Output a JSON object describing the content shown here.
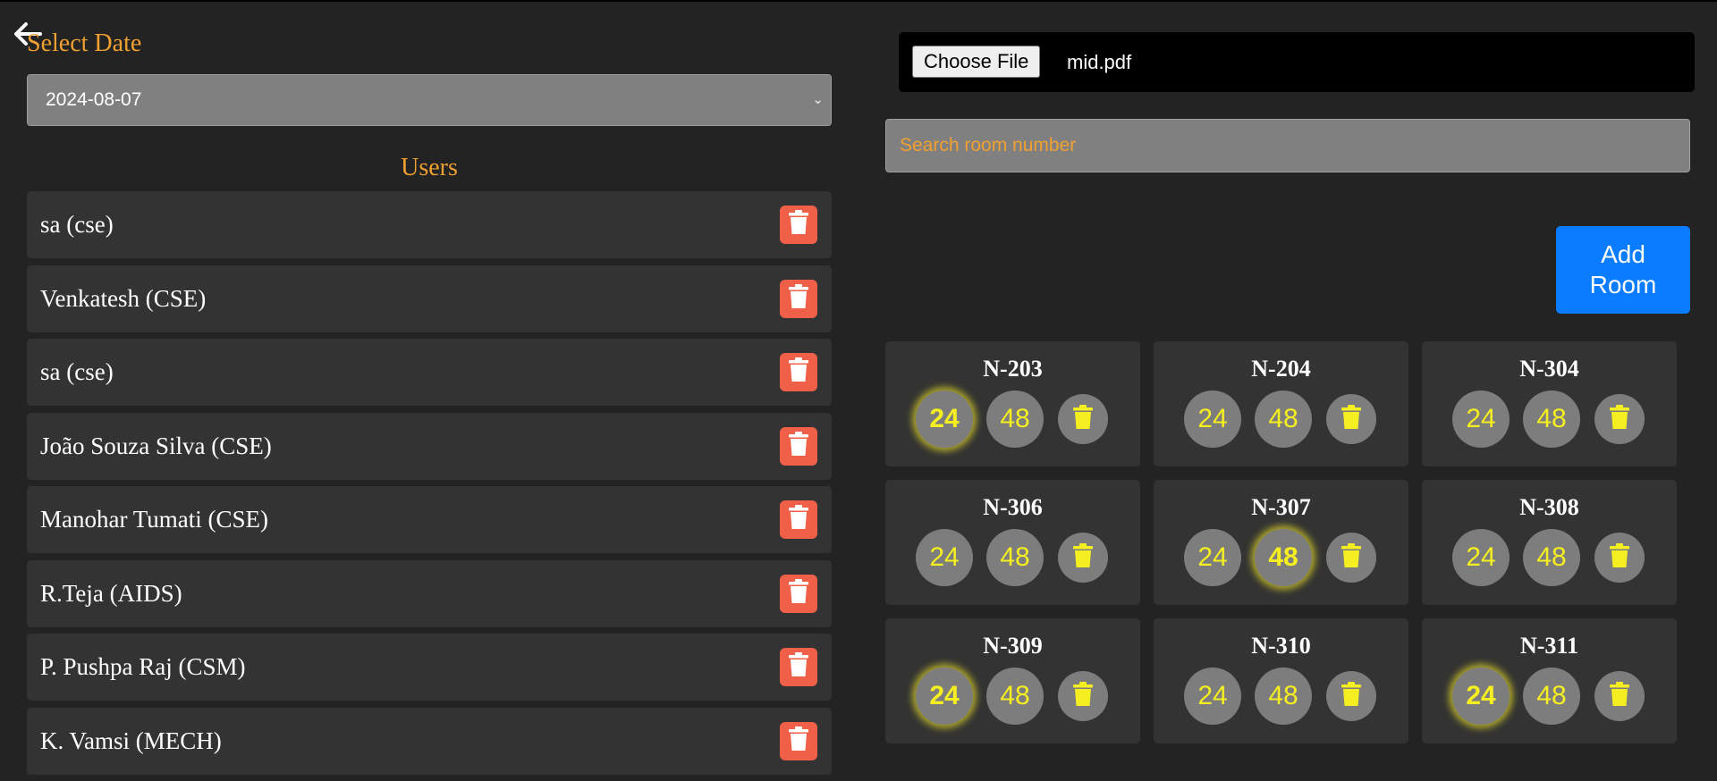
{
  "header": {
    "back_icon": "arrow-left-icon"
  },
  "date_section": {
    "label": "Select Date",
    "selected_date": "2024-08-07"
  },
  "users_section": {
    "title": "Users",
    "users": [
      {
        "name": "sa (cse)"
      },
      {
        "name": "Venkatesh (CSE)"
      },
      {
        "name": "sa (cse)"
      },
      {
        "name": "João Souza Silva (CSE)"
      },
      {
        "name": "Manohar Tumati (CSE)"
      },
      {
        "name": "R.Teja (AIDS)"
      },
      {
        "name": "P. Pushpa Raj (CSM)"
      },
      {
        "name": "K. Vamsi (MECH)"
      }
    ],
    "delete_icon": "trash-icon",
    "delete_color": "#f06048"
  },
  "upload": {
    "button_label": "Choose File",
    "file_name": "mid.pdf"
  },
  "search": {
    "placeholder": "Search room number"
  },
  "add_room": {
    "label": "Add Room",
    "color": "#0a7cff"
  },
  "rooms": [
    {
      "name": "N-203",
      "option_a": "24",
      "option_b": "48",
      "selected": "24"
    },
    {
      "name": "N-204",
      "option_a": "24",
      "option_b": "48",
      "selected": ""
    },
    {
      "name": "N-304",
      "option_a": "24",
      "option_b": "48",
      "selected": ""
    },
    {
      "name": "N-306",
      "option_a": "24",
      "option_b": "48",
      "selected": ""
    },
    {
      "name": "N-307",
      "option_a": "24",
      "option_b": "48",
      "selected": "48"
    },
    {
      "name": "N-308",
      "option_a": "24",
      "option_b": "48",
      "selected": ""
    },
    {
      "name": "N-309",
      "option_a": "24",
      "option_b": "48",
      "selected": "24"
    },
    {
      "name": "N-310",
      "option_a": "24",
      "option_b": "48",
      "selected": ""
    },
    {
      "name": "N-311",
      "option_a": "24",
      "option_b": "48",
      "selected": "24"
    }
  ],
  "colors": {
    "accent": "#f0a030",
    "background": "#232323",
    "card": "#333333",
    "capacity_text": "#f5ee20"
  }
}
